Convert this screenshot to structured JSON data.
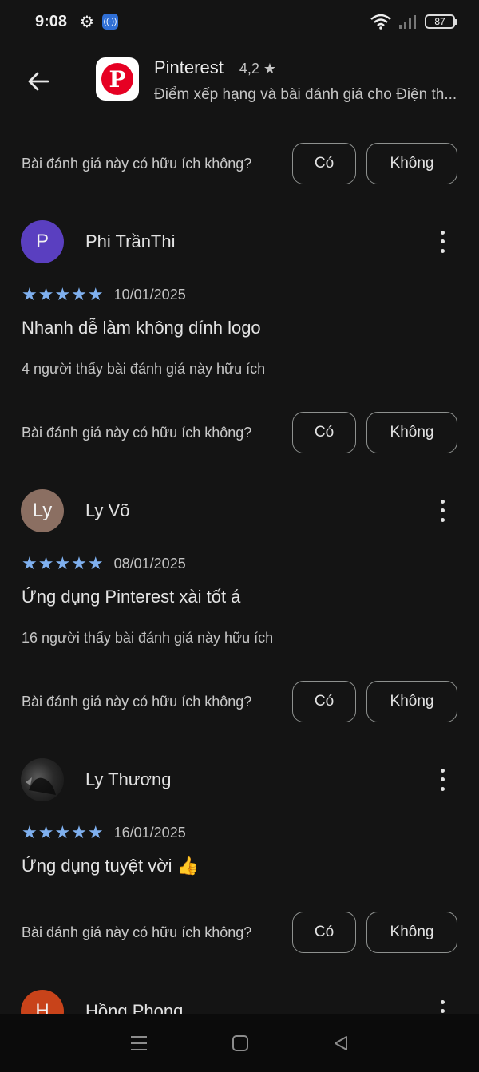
{
  "status_bar": {
    "time": "9:08",
    "battery": "87",
    "icons": [
      "gear-icon",
      "hotspot-icon",
      "wifi-icon",
      "signal-icon",
      "battery-icon"
    ]
  },
  "header": {
    "back_icon": "arrow-left-icon",
    "app_name": "Pinterest",
    "rating": "4,2 ★",
    "subtitle": "Điểm xếp hạng và bài đánh giá cho Điện th..."
  },
  "helpful": {
    "question": "Bài đánh giá này có hữu ích không?",
    "yes_label": "Có",
    "no_label": "Không"
  },
  "reviews": [
    {
      "avatar_text": "P",
      "avatar_color": "#5a3fc0",
      "name": "Phi TrầnThi",
      "stars": "★★★★★",
      "rating": 5,
      "date": "10/01/2025",
      "text": "Nhanh dễ làm không dính logo",
      "helpful_count": "4 người thấy bài đánh giá này hữu ích"
    },
    {
      "avatar_text": "Ly",
      "avatar_color": "#8b6f62",
      "name": "Ly Võ",
      "stars": "★★★★★",
      "rating": 5,
      "date": "08/01/2025",
      "text": "Ứng dụng Pinterest xài tốt á",
      "helpful_count": "16 người thấy bài đánh giá này hữu ích"
    },
    {
      "avatar_text": "",
      "avatar_color": "#2a2a2a",
      "name": "Ly Thương",
      "stars": "★★★★★",
      "rating": 5,
      "date": "16/01/2025",
      "text": "Ứng dụng tuyệt vời 👍"
    },
    {
      "avatar_text": "H",
      "avatar_color": "#c8431a",
      "name": "Hồng Phong"
    }
  ],
  "nav_bar": {
    "icons": [
      "menu-icon",
      "home-icon",
      "back-triangle-icon"
    ]
  }
}
